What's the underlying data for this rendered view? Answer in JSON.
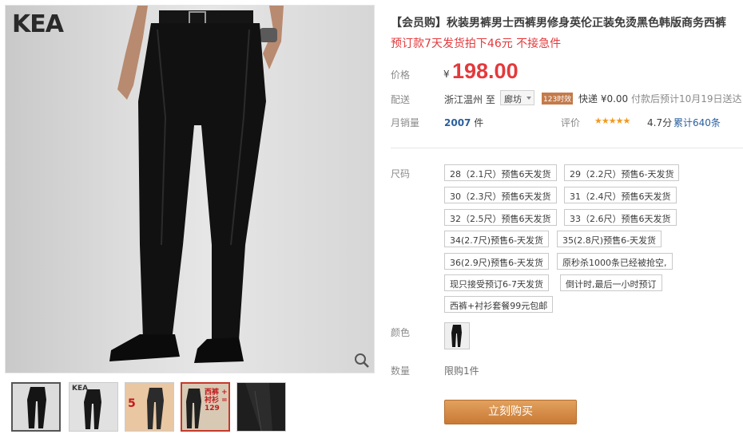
{
  "gallery": {
    "brand": "KEA",
    "thumbs": [
      {
        "label": ""
      },
      {
        "label": "KEA"
      },
      {
        "label": "5"
      },
      {
        "label": "西裤 + 衬衫 = 129"
      },
      {
        "label": ""
      }
    ]
  },
  "product": {
    "title": "【会员购】秋装男裤男士西裤男修身英伦正装免烫黑色韩版商务西裤",
    "promo": "预订款7天发货拍下46元 不接急件",
    "price_label": "价格",
    "currency": "¥",
    "price": "198.00",
    "shipping": {
      "label": "配送",
      "from": "浙江温州 至",
      "to": "廊坊",
      "badge": "123时效",
      "fee_prefix": "快递 ¥0.00",
      "fee_note": "付款后预计10月19日送达"
    },
    "sales": {
      "label": "月销量",
      "count": "2007",
      "unit": "件"
    },
    "rating": {
      "label": "评价",
      "stars": "★★★★★",
      "score": "4.7分",
      "reviews": "累计640条"
    }
  },
  "sku": {
    "size_label": "尺码",
    "sizes": [
      "28（2.1尺）预售6天发货",
      "29（2.2尺）预售6-天发货",
      "30（2.3尺）预售6天发货",
      "31（2.4尺）预售6天发货",
      "32（2.5尺）预售6天发货",
      "33（2.6尺）预售6天发货",
      "34(2.7尺)预售6-天发货",
      "35(2.8尺)预售6-天发货",
      "36(2.9尺)预售6-天发货",
      "原秒杀1000条已经被抢空,",
      "现只接受预订6-7天发货",
      "倒计时,最后一小时预订",
      "西裤+衬衫套餐99元包邮"
    ],
    "color_label": "颜色",
    "quantity_label": "数量",
    "quantity_limit": "限购1件"
  },
  "actions": {
    "buy_now": "立刻购买"
  }
}
